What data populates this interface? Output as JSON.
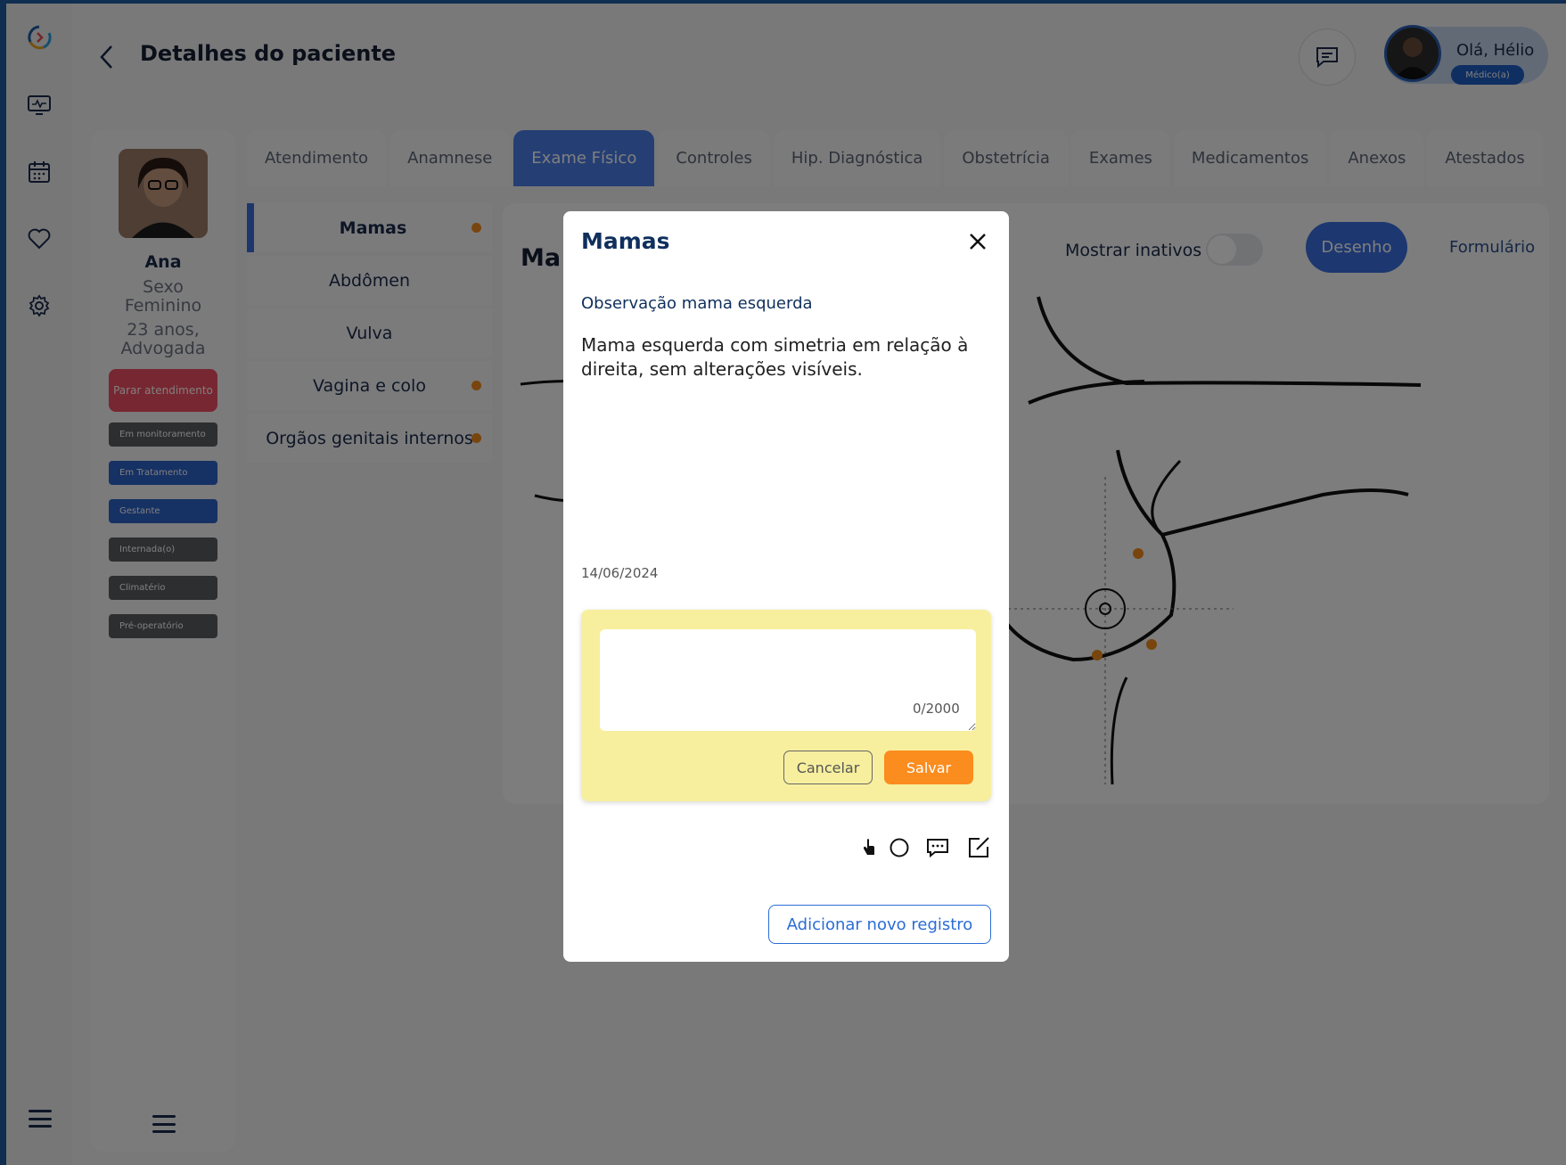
{
  "header": {
    "title": "Detalhes do paciente"
  },
  "user": {
    "greeting": "Olá, Hélio",
    "role": "Médico(a)"
  },
  "patient": {
    "name": "Ana",
    "sex_label": "Sexo",
    "sex": "Feminino",
    "age": "23 anos,",
    "occupation": "Advogada",
    "stop_button": "Parar atendimento",
    "tags": [
      {
        "label": "Em monitoramento",
        "color": "#5b5d61"
      },
      {
        "label": "Em Tratamento",
        "color": "#2d63c8"
      },
      {
        "label": "Gestante",
        "color": "#2d63c8"
      },
      {
        "label": "Internada(o)",
        "color": "#5b5d61"
      },
      {
        "label": "Climatério",
        "color": "#5b5d61"
      },
      {
        "label": "Pré-operatório",
        "color": "#5b5d61"
      }
    ]
  },
  "tabs": [
    "Atendimento",
    "Anamnese",
    "Exame Físico",
    "Controles",
    "Hip. Diagnóstica",
    "Obstetrícia",
    "Exames",
    "Medicamentos",
    "Anexos",
    "Atestados"
  ],
  "active_tab": "Exame Físico",
  "sections": [
    {
      "label": "Mamas",
      "dot": true
    },
    {
      "label": "Abdômen",
      "dot": false
    },
    {
      "label": "Vulva",
      "dot": false
    },
    {
      "label": "Vagina e colo",
      "dot": true
    },
    {
      "label": "Orgãos genitais internos",
      "dot": true
    }
  ],
  "content": {
    "heading_partial": "Ma",
    "show_inactive": "Mostrar inativos",
    "mode_drawing": "Desenho",
    "mode_form": "Formulário"
  },
  "modal": {
    "title": "Mamas",
    "subtitle": "Observação mama esquerda",
    "text": "Mama esquerda com simetria em relação à direita, sem alterações visíveis.",
    "date": "14/06/2024",
    "counter": "0/2000",
    "cancel": "Cancelar",
    "save": "Salvar",
    "add_record": "Adicionar novo registro"
  },
  "colors": {
    "accent": "#3a6fe0",
    "orange": "#fb8c1e",
    "note_bg": "#f7ef9e"
  }
}
